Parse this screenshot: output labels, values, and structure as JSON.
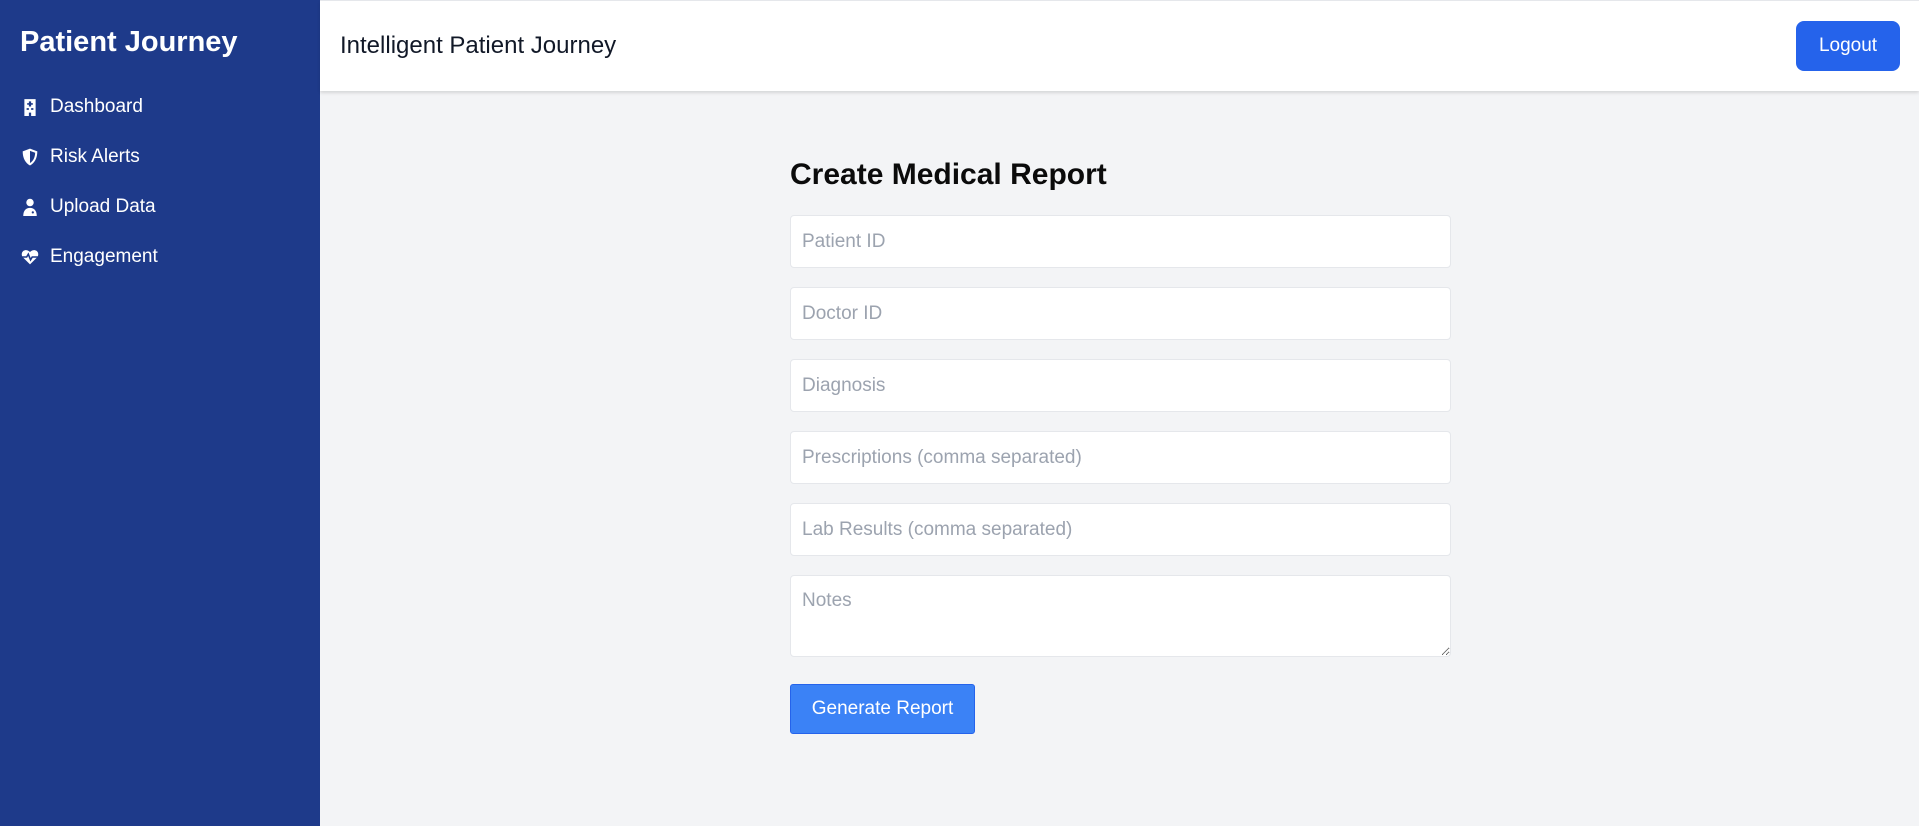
{
  "sidebar": {
    "brand": "Patient Journey",
    "items": [
      {
        "label": "Dashboard",
        "icon": "hospital-icon"
      },
      {
        "label": "Risk Alerts",
        "icon": "shield-icon"
      },
      {
        "label": "Upload Data",
        "icon": "user-doctor-icon"
      },
      {
        "label": "Engagement",
        "icon": "heart-pulse-icon"
      }
    ]
  },
  "header": {
    "title": "Intelligent Patient Journey",
    "logout_label": "Logout"
  },
  "form": {
    "title": "Create Medical Report",
    "patient_id": {
      "value": "",
      "placeholder": "Patient ID"
    },
    "doctor_id": {
      "value": "",
      "placeholder": "Doctor ID"
    },
    "diagnosis": {
      "value": "",
      "placeholder": "Diagnosis"
    },
    "prescriptions": {
      "value": "",
      "placeholder": "Prescriptions (comma separated)"
    },
    "lab_results": {
      "value": "",
      "placeholder": "Lab Results (comma separated)"
    },
    "notes": {
      "value": "",
      "placeholder": "Notes"
    },
    "submit_label": "Generate Report"
  },
  "colors": {
    "sidebar_bg": "#1e3a8a",
    "primary": "#2563eb",
    "button": "#3b82f6",
    "page_bg": "#f3f4f6"
  }
}
